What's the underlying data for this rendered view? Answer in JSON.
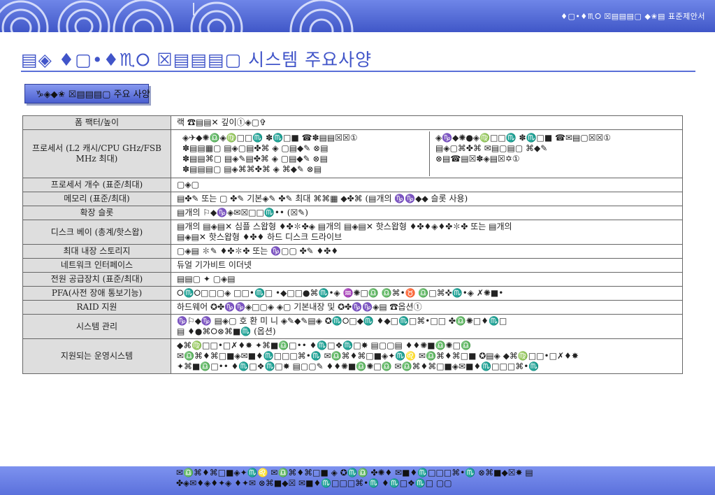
{
  "header": {
    "banner_text": "♦▢•♦♏⭘ ☒▤▤▤▢ ◆✬▤ 표준제안서"
  },
  "title": "▤◈ ♦▢•♦♏⭘ ☒▤▤▤▢ 시스템 주요사양",
  "section": {
    "label": "♑◈◆✬ ☒▤▤▤▢ 주요 사양"
  },
  "spec_rows": [
    {
      "label": "폼 팩터/높이",
      "lines": [
        "랙 ☎▤▤✕ 깊이①◈▢✞"
      ]
    },
    {
      "label": "프로세서 (L2 캐시/CPU GHz/FSB MHz 최대)",
      "split": true,
      "left": [
        "◈✈◆✺♎◈♍□□♏ ✽♏□■ ☎✽▤▤☒☒①",
        "✽▤▤▦▢ ▤◈▢▤✤⌘ ◈ ▢▤◆✎ ⊗▤",
        "✽▤▤⌘▢ ▤◈✎▤✤⌘ ◈ ▢▤◆✎ ⊗▤",
        "✽▤▤▤▢ ▤◈⌘⌘✤⌘ ◈ ⌘◆✎ ⊗▤"
      ],
      "right": [
        "◈♑◆✺●◈♍□□♏ ✽♏□■ ☎✉▤▢☒☒①",
        "▤◈▢⌘✤⌘ ✉▤▢▤▢ ⌘◆✎",
        "⊗▤☎▤☒✽◈▤☒✡①"
      ]
    },
    {
      "label": "프로세서 개수 (표준/최대)",
      "lines": [
        "▢◈▢"
      ]
    },
    {
      "label": "메모리 (표준/최대)",
      "lines": [
        "▤✤✎ 또는 ▢ ✤✎ 기본◈✎ ✤✎ 최대 ⌘⌘▦ ◆✤⌘ (▤개의 ♑♑◆◆ 슬롯 사용)"
      ]
    },
    {
      "label": "확장 슬롯",
      "lines": [
        "▤개의 ⚐◆♑◈✉☒□□♏•• (☒✎)"
      ]
    },
    {
      "label": "디스크 베이 (총계/핫스왑)",
      "lines": [
        "▤개의 ▤◈▤✕ 심플 스왑형 ♦✤✽✤◈ ▤개의 ▤◈▤✕ 핫스왑형 ♦✤♦◈♦✤✽✤ 또는 ▤개의",
        "▤◈▤✕ 핫스왑형 ♦✤♦ 하드 디스크 드라이브"
      ]
    },
    {
      "label": "최대 내장 스토리지",
      "lines": [
        "▢◈▤ ✽✎ ♦✤✽✤ 또는 ♑▢▢ ✤✎ ♦✤♦"
      ]
    },
    {
      "label": "네트워크 인터페이스",
      "lines": [
        "듀얼 기가비트 이더넷"
      ]
    },
    {
      "label": "전원 공급장치 (표준/최대)",
      "lines": [
        "▤▤▢ ✦ ▢◈▤"
      ]
    },
    {
      "label": "PFA(사전 장애 통보기능)",
      "lines": [
        "⭘♏⭘□□▢◈ □□•♏□ •◆□□●⌘♏•◈ ♒✺□♎ ♎⌘•♉ ♎□⌘✜♏•◈ ✗✺■•"
      ]
    },
    {
      "label": "RAID 지원",
      "lines": [
        "하드웨어 ✪✤♑♑◈□▢◈ ◈▢ 기본내장 및 ✪✤♑♑◈▤ ☎옵션①"
      ]
    },
    {
      "label": "시스템 관리",
      "lines": [
        "♑⚐◆♑ ▤◈▢ 호 환 미 니 ◈✎◆✎▤◈ ✪♏⭘□◆♏ ♦◆□♏□⌘•□□ ✤♎✺□♦♏□",
        "▤ ♦●⌘⭘⊗⌘■♏ (옵션)"
      ]
    },
    {
      "label": "지원되는 운영시스템",
      "lines": [
        "◆⌘♍□□•□✗♦✸ ✦⌘■♎□•• ♦♏□❖♏□✸ ▤▢▢▤ ♦♦✺■♎✺□♎",
        "✉♎⌘♦⌘□■◈✉■♦♏□□□⌘•♏ ✉♎⌘♦⌘□■◈✦♏♌ ✉♎⌘♦⌘□■ ✪▤◈ ◆⌘♍□□•□✗♦✸",
        "✦⌘■♎□•• ♦♏□❖♏□✸ ▤▢▢✎ ♦♦✺■♎✺□♎ ✉♎⌘♦⌘□■◈✉■♦♏□□□⌘•♏"
      ]
    }
  ],
  "footer": {
    "os_lines": [
      "✉♎⌘♦⌘□■◈✦♏♌ ✉♎⌘♦⌘□■ ◈ ✪♏♎ ✤✺♦ ✉■♦♏□□□⌘•♏ ⊗⌘■◆☒✸ ▤",
      "✤◈✉♦◈♦✦◈ ♦✦✉ ⊗⌘■◆☒ ✉■♦♏□□□⌘•♏ ♦♏□❖♏□ ▢▢"
    ]
  }
}
